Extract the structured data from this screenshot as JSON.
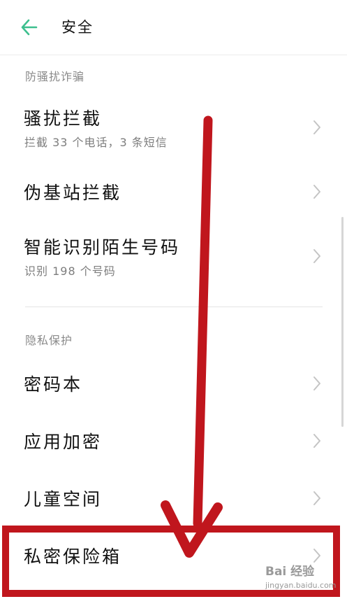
{
  "header": {
    "title": "安全",
    "back_icon": "arrow-left-icon",
    "accent_color": "#3dbf8e"
  },
  "sections": [
    {
      "header": "防骚扰诈骗",
      "items": [
        {
          "title": "骚扰拦截",
          "subtitle": "拦截 33 个电话，3 条短信"
        },
        {
          "title": "伪基站拦截"
        },
        {
          "title": "智能识别陌生号码",
          "subtitle": "识别 198 个号码"
        }
      ]
    },
    {
      "header": "隐私保护",
      "items": [
        {
          "title": "密码本"
        },
        {
          "title": "应用加密"
        },
        {
          "title": "儿童空间"
        },
        {
          "title": "私密保险箱"
        }
      ]
    }
  ],
  "annotation": {
    "color": "#c0161d"
  },
  "watermark": {
    "logo": "Bai 经验",
    "url": "jingyan.baidu.com"
  }
}
